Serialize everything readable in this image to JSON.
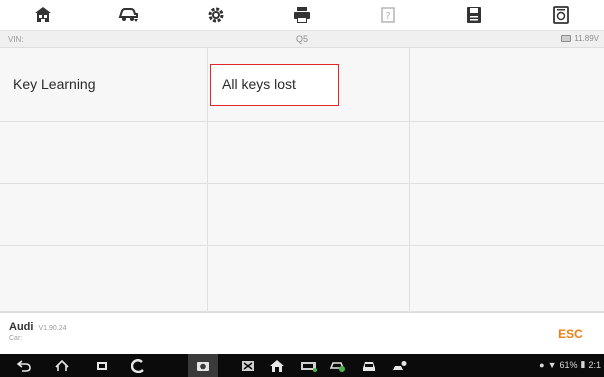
{
  "toolbar": {
    "items": [
      {
        "icon": "home-icon"
      },
      {
        "icon": "vehicle-swap-icon"
      },
      {
        "icon": "settings-icon"
      },
      {
        "icon": "print-icon"
      },
      {
        "icon": "help-icon"
      },
      {
        "icon": "save-icon"
      },
      {
        "icon": "data-logging-icon"
      }
    ]
  },
  "info_bar": {
    "vin_label": "VIN:",
    "model": "Q5",
    "voltage": "11.89V"
  },
  "menu": {
    "items": [
      {
        "label": "Key Learning"
      },
      {
        "label": "All keys lost",
        "selected": true
      }
    ]
  },
  "footer": {
    "brand": "Audi",
    "version": "V1.90.24",
    "car_label": "Car:",
    "esc_label": "ESC"
  },
  "status_bar": {
    "battery": "61%",
    "time": "2:1"
  },
  "colors": {
    "accent_orange": "#f07d12",
    "selection_red": "#e0282e",
    "grid_bg": "#f7f7f7",
    "nav_bg": "#0b0b0b"
  }
}
